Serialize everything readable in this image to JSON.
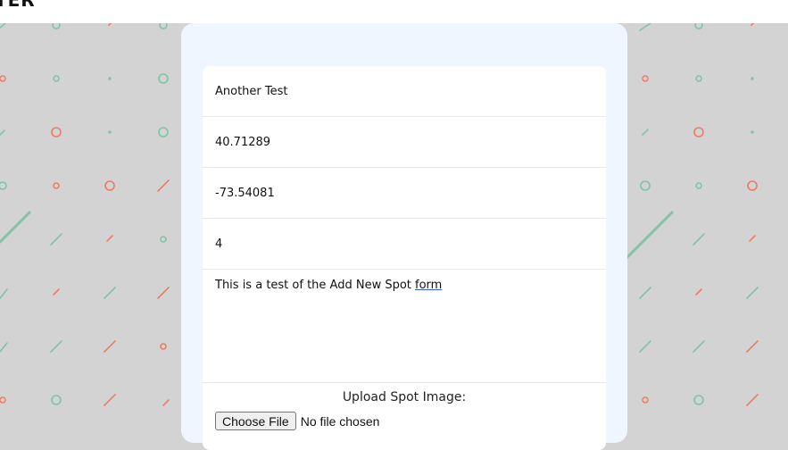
{
  "header": {
    "brand_fragment": "TER"
  },
  "form": {
    "name_value": "Another Test",
    "latitude_value": "40.71289",
    "longitude_value": "-73.54081",
    "rating_value": "4",
    "description_text": "This is a test of the Add New Spot ",
    "description_underlined": "form",
    "upload_label": "Upload Spot Image:",
    "choose_file_label": "Choose File",
    "no_file_text": "No file chosen"
  },
  "colors": {
    "background": "#d3d3d3",
    "card": "#f0f6ff",
    "pattern_green": "#7fc4a4",
    "pattern_red": "#ef7b65"
  }
}
